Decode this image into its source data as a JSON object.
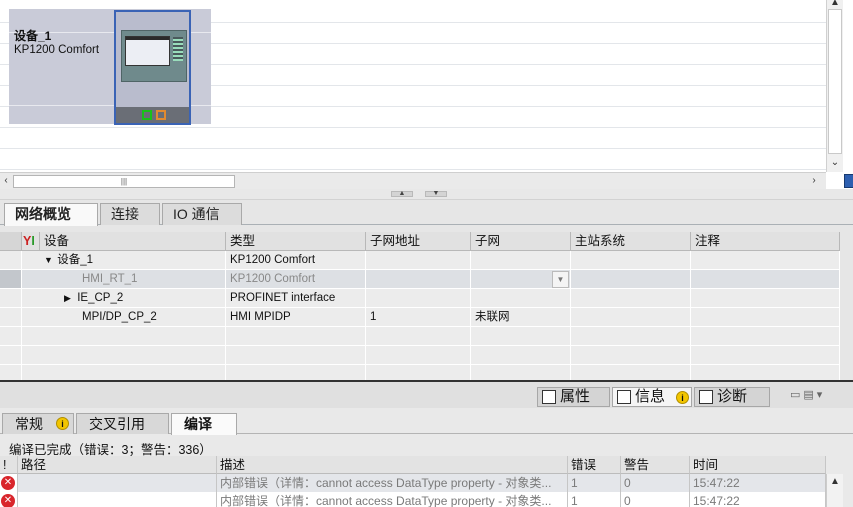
{
  "network_view": {
    "device_name": "设备_1",
    "device_type": "KP1200 Comfort"
  },
  "overview_tabs": [
    {
      "label": "网络概览",
      "active": true
    },
    {
      "label": "连接",
      "active": false
    },
    {
      "label": "IO 通信",
      "active": false
    }
  ],
  "overview_table": {
    "headers": [
      "设备",
      "类型",
      "子网地址",
      "子网",
      "主站系统",
      "注释"
    ],
    "rows": [
      {
        "device": "设备_1",
        "type": "KP1200 Comfort",
        "address": "",
        "subnet": "",
        "master": "",
        "comment": "",
        "expander": "down"
      },
      {
        "device": "HMI_RT_1",
        "type": "KP1200 Comfort",
        "address": "",
        "subnet": "",
        "master": "",
        "comment": "",
        "expander": ""
      },
      {
        "device": "IE_CP_2",
        "type": "PROFINET interface",
        "address": "",
        "subnet": "",
        "master": "",
        "comment": "",
        "expander": "right"
      },
      {
        "device": "MPI/DP_CP_2",
        "type": "HMI MPIDP",
        "address": "1",
        "subnet": "未联网",
        "master": "",
        "comment": "",
        "expander": ""
      }
    ]
  },
  "inspector": {
    "buttons": [
      {
        "label": "属性",
        "icon": "properties-icon"
      },
      {
        "label": "信息",
        "icon": "info-icon"
      },
      {
        "label": "诊断",
        "icon": "diagnostics-icon"
      }
    ],
    "tabs": [
      {
        "label": "常规"
      },
      {
        "label": "交叉引用"
      },
      {
        "label": "编译"
      }
    ],
    "compile_summary": "编译已完成（错误：3；警告：336）",
    "message_headers": [
      "!",
      "路径",
      "描述",
      "错误",
      "警告",
      "时间"
    ],
    "messages": [
      {
        "path": "",
        "description": "内部错误（详情：cannot access DataType property - 对象类...",
        "errors": "1",
        "warnings": "0",
        "time": "15:47:22"
      },
      {
        "path": "",
        "description": "内部错误（详情：cannot access DataType property - 对象类...",
        "errors": "1",
        "warnings": "0",
        "time": "15:47:22"
      }
    ]
  },
  "colors": {
    "selection_blue": "#3a63b5",
    "error_red": "#d9262c",
    "info_yellow": "#f2c500"
  }
}
